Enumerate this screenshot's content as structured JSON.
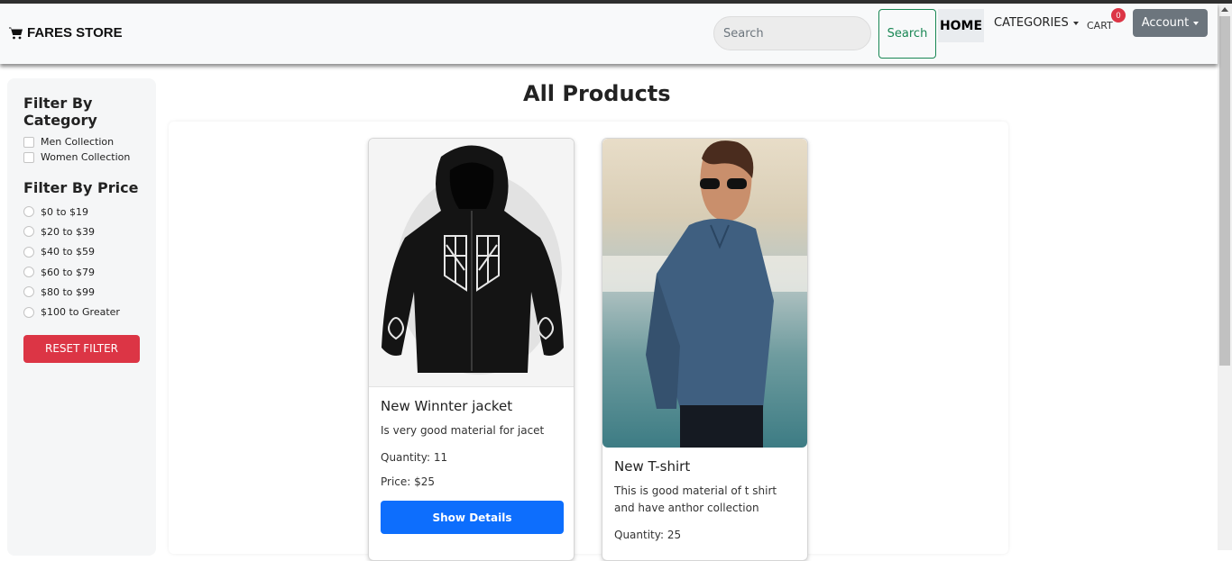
{
  "navbar": {
    "brand": "FARES STORE",
    "search_placeholder": "Search",
    "search_button": "Search",
    "home": "HOME",
    "categories": "CATEGORIES",
    "cart": "CART",
    "cart_count": "0",
    "account": "Account"
  },
  "sidebar": {
    "category_heading": "Filter By Category",
    "categories": [
      "Men Collection",
      "Women Collection"
    ],
    "price_heading": "Filter By Price",
    "prices": [
      "$0 to $19",
      "$20 to $39",
      "$40 to $59",
      "$60 to $79",
      "$80 to $99",
      "$100 to Greater"
    ],
    "reset_button": "RESET FILTER"
  },
  "main": {
    "title": "All Products",
    "products": [
      {
        "name": "New Winnter jacket",
        "description": "Is very good material for jacet",
        "quantity": "Quantity: 11",
        "price": "Price: $25",
        "button": "Show Details"
      },
      {
        "name": "New T-shirt",
        "description": "This is good material of t shirt and have anthor collection",
        "quantity": "Quantity: 25"
      }
    ]
  },
  "colors": {
    "primary": "#0d6efd",
    "danger": "#dc3545",
    "success": "#198754",
    "secondary": "#6c757d"
  }
}
